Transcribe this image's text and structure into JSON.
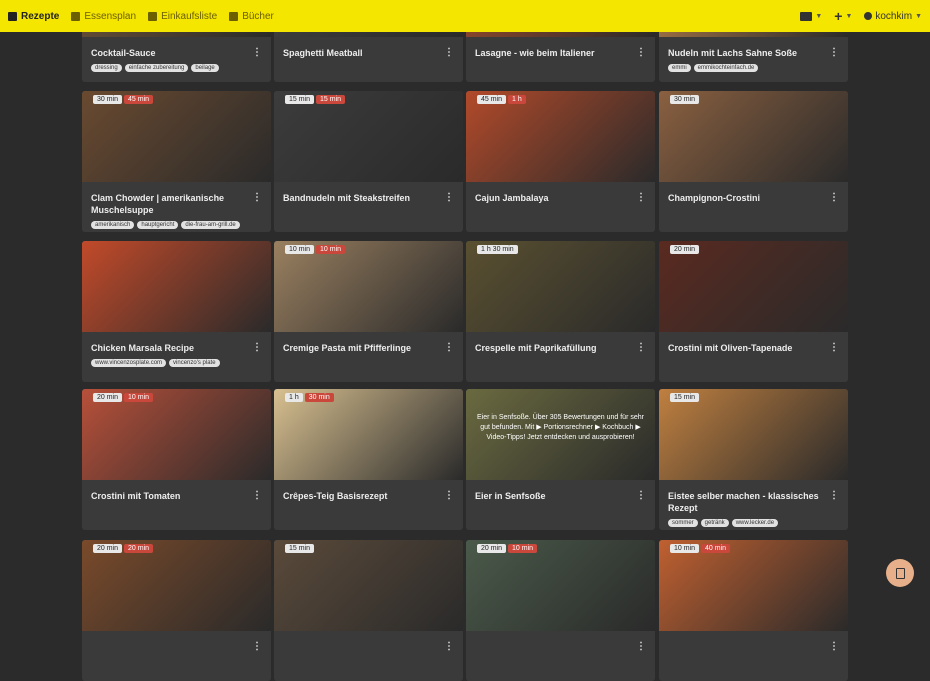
{
  "nav": {
    "items": [
      {
        "label": "Rezepte",
        "icon": "book-icon",
        "active": true
      },
      {
        "label": "Essensplan",
        "icon": "calendar-icon",
        "active": false
      },
      {
        "label": "Einkaufsliste",
        "icon": "cart-icon",
        "active": false
      },
      {
        "label": "Bücher",
        "icon": "books-icon",
        "active": false
      }
    ],
    "right": {
      "user": "kochkim"
    }
  },
  "cards": [
    {
      "title": "Cocktail-Sauce",
      "tags": [
        "dressing",
        "einfache zubereitung",
        "beilage"
      ],
      "badges": []
    },
    {
      "title": "Spaghetti Meatball",
      "tags": [],
      "badges": []
    },
    {
      "title": "Lasagne - wie beim Italiener",
      "tags": [],
      "badges": []
    },
    {
      "title": "Nudeln mit Lachs Sahne Soße",
      "tags": [
        "emmi",
        "emmikochteinfach.de"
      ],
      "badges": []
    },
    {
      "title": "Clam Chowder | amerikanische Muschelsuppe",
      "tags": [
        "amerikanisch",
        "hauptgericht",
        "die-frau-am-grill.de"
      ],
      "badges": [
        "30 min",
        "45 min"
      ]
    },
    {
      "title": "Bandnudeln mit Steakstreifen",
      "tags": [],
      "badges": [
        "15 min",
        "15 min"
      ]
    },
    {
      "title": "Cajun Jambalaya",
      "tags": [],
      "badges": [
        "45 min",
        "1 h"
      ]
    },
    {
      "title": "Champignon-Crostini",
      "tags": [],
      "badges": [
        "30 min"
      ]
    },
    {
      "title": "Chicken Marsala Recipe",
      "tags": [
        "www.vincenzosplate.com",
        "vincenzo's plate"
      ],
      "badges": []
    },
    {
      "title": "Cremige Pasta mit Pfifferlinge",
      "tags": [],
      "badges": [
        "10 min",
        "10 min"
      ]
    },
    {
      "title": "Crespelle mit Paprikafüllung",
      "tags": [],
      "badges": [
        "1 h 30 min"
      ]
    },
    {
      "title": "Crostini mit Oliven-Tapenade",
      "tags": [],
      "badges": [
        "20 min"
      ]
    },
    {
      "title": "Crostini mit Tomaten",
      "tags": [],
      "badges": [
        "20 min",
        "10 min"
      ]
    },
    {
      "title": "Crêpes-Teig Basisrezept",
      "tags": [],
      "badges": [
        "1 h",
        "30 min"
      ]
    },
    {
      "title": "Eier in Senfsoße",
      "tags": [],
      "badges": [],
      "overlay": "Eier in Senfsoße. Über 305 Bewertungen und für sehr gut befunden. Mit ▶ Portionsrechner ▶ Kochbuch ▶ Video-Tipps! Jetzt entdecken und ausprobieren!"
    },
    {
      "title": "Eistee selber machen - klassisches Rezept",
      "tags": [
        "sommer",
        "getränk",
        "www.lecker.de"
      ],
      "badges": [
        "15 min"
      ]
    },
    {
      "title": "",
      "tags": [],
      "badges": [
        "20 min",
        "20 min"
      ]
    },
    {
      "title": "",
      "tags": [],
      "badges": [
        "15 min"
      ]
    },
    {
      "title": "",
      "tags": [],
      "badges": [
        "20 min",
        "10 min"
      ]
    },
    {
      "title": "",
      "tags": [],
      "badges": [
        "10 min",
        "40 min"
      ]
    }
  ],
  "colors": {
    "accent": "#f5e600",
    "background": "#2b2b2b",
    "card": "#3a3a3a"
  }
}
